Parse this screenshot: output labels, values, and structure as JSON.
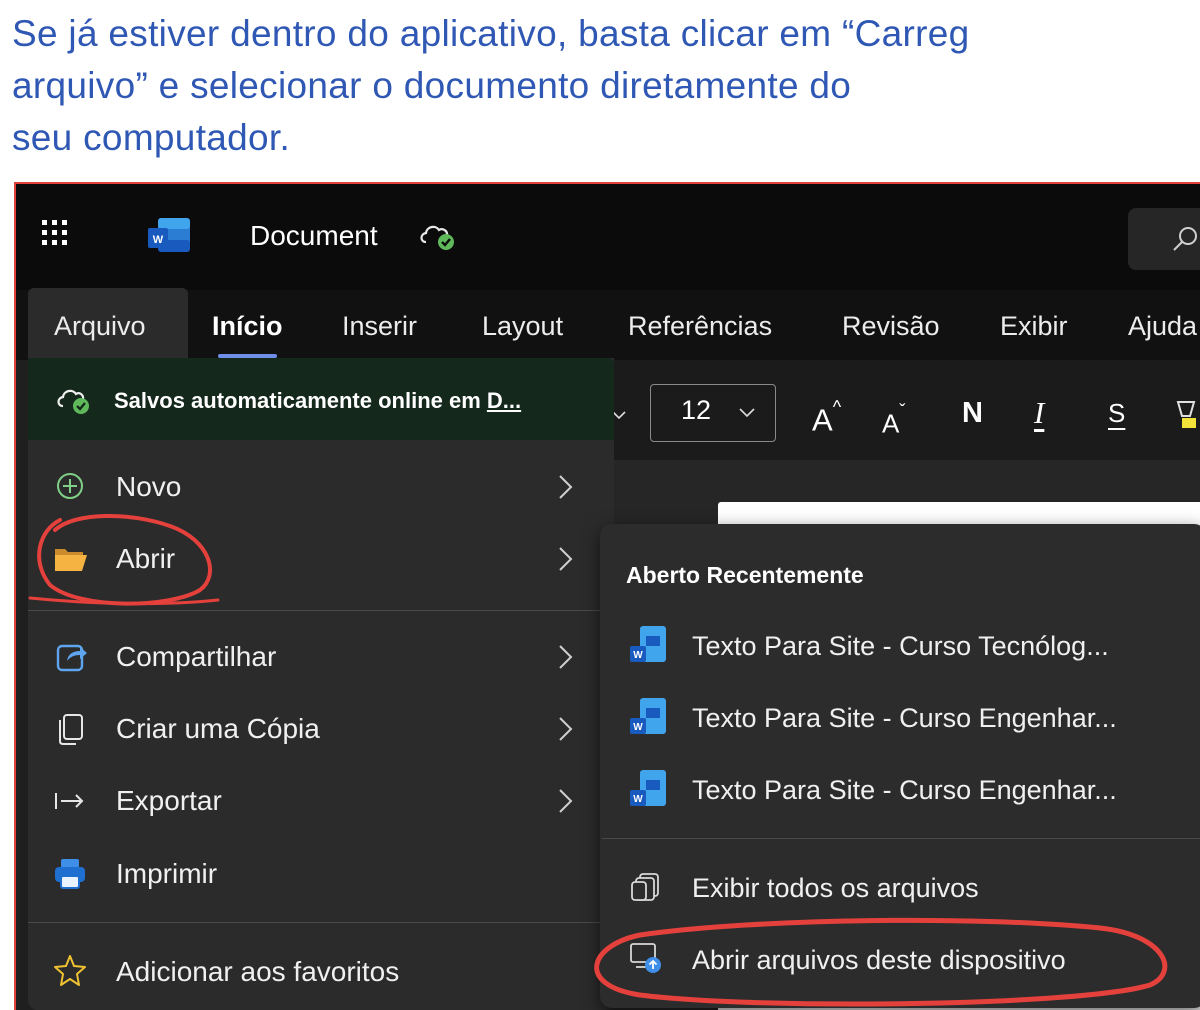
{
  "caption": {
    "line1": "Se já estiver dentro do aplicativo, basta clicar em “Carreg",
    "line2": "arquivo” e selecionar o documento diretamente do",
    "line3": "seu computador."
  },
  "titlebar": {
    "app_icon": "word-icon",
    "document_title": "Document",
    "cloud_status_icon": "cloud-saved-icon",
    "search_icon": "search-icon"
  },
  "ribbon": {
    "tabs": [
      {
        "label": "Arquivo",
        "state": "open"
      },
      {
        "label": "Início",
        "state": "selected"
      },
      {
        "label": "Inserir"
      },
      {
        "label": "Layout"
      },
      {
        "label": "Referências"
      },
      {
        "label": "Revisão"
      },
      {
        "label": "Exibir"
      },
      {
        "label": "Ajuda"
      }
    ]
  },
  "toolbar": {
    "font_size": "12",
    "grow_font": "A",
    "shrink_font": "A",
    "bold": "N",
    "italic": "I",
    "strikethrough": "S"
  },
  "file_menu": {
    "autosave_text": "Salvos automaticamente online em ",
    "autosave_link": "D...",
    "items": [
      {
        "label": "Novo",
        "icon": "plus-circle-icon",
        "has_submenu": true
      },
      {
        "label": "Abrir",
        "icon": "folder-open-icon",
        "has_submenu": true
      },
      {
        "label": "Compartilhar",
        "icon": "share-icon",
        "has_submenu": true
      },
      {
        "label": "Criar uma Cópia",
        "icon": "copy-icon",
        "has_submenu": true
      },
      {
        "label": "Exportar",
        "icon": "export-arrow-icon",
        "has_submenu": true
      },
      {
        "label": "Imprimir",
        "icon": "printer-icon",
        "has_submenu": false
      },
      {
        "label": "Adicionar aos favoritos",
        "icon": "star-icon",
        "has_submenu": false
      }
    ]
  },
  "open_submenu": {
    "heading": "Aberto Recentemente",
    "recent_files": [
      {
        "label": "Texto Para Site - Curso Tecnólog..."
      },
      {
        "label": "Texto Para Site - Curso Engenhar..."
      },
      {
        "label": "Texto Para Site - Curso Engenhar..."
      }
    ],
    "view_all": "Exibir todos os arquivos",
    "open_from_device": "Abrir arquivos deste dispositivo"
  },
  "colors": {
    "caption_text": "#2f57b4",
    "annotation_red": "#e5413c",
    "menu_bg": "#2b2b2b",
    "autosave_bg": "#15281c",
    "accent_tab": "#6f8ee8",
    "word_blue": "#185abd"
  }
}
